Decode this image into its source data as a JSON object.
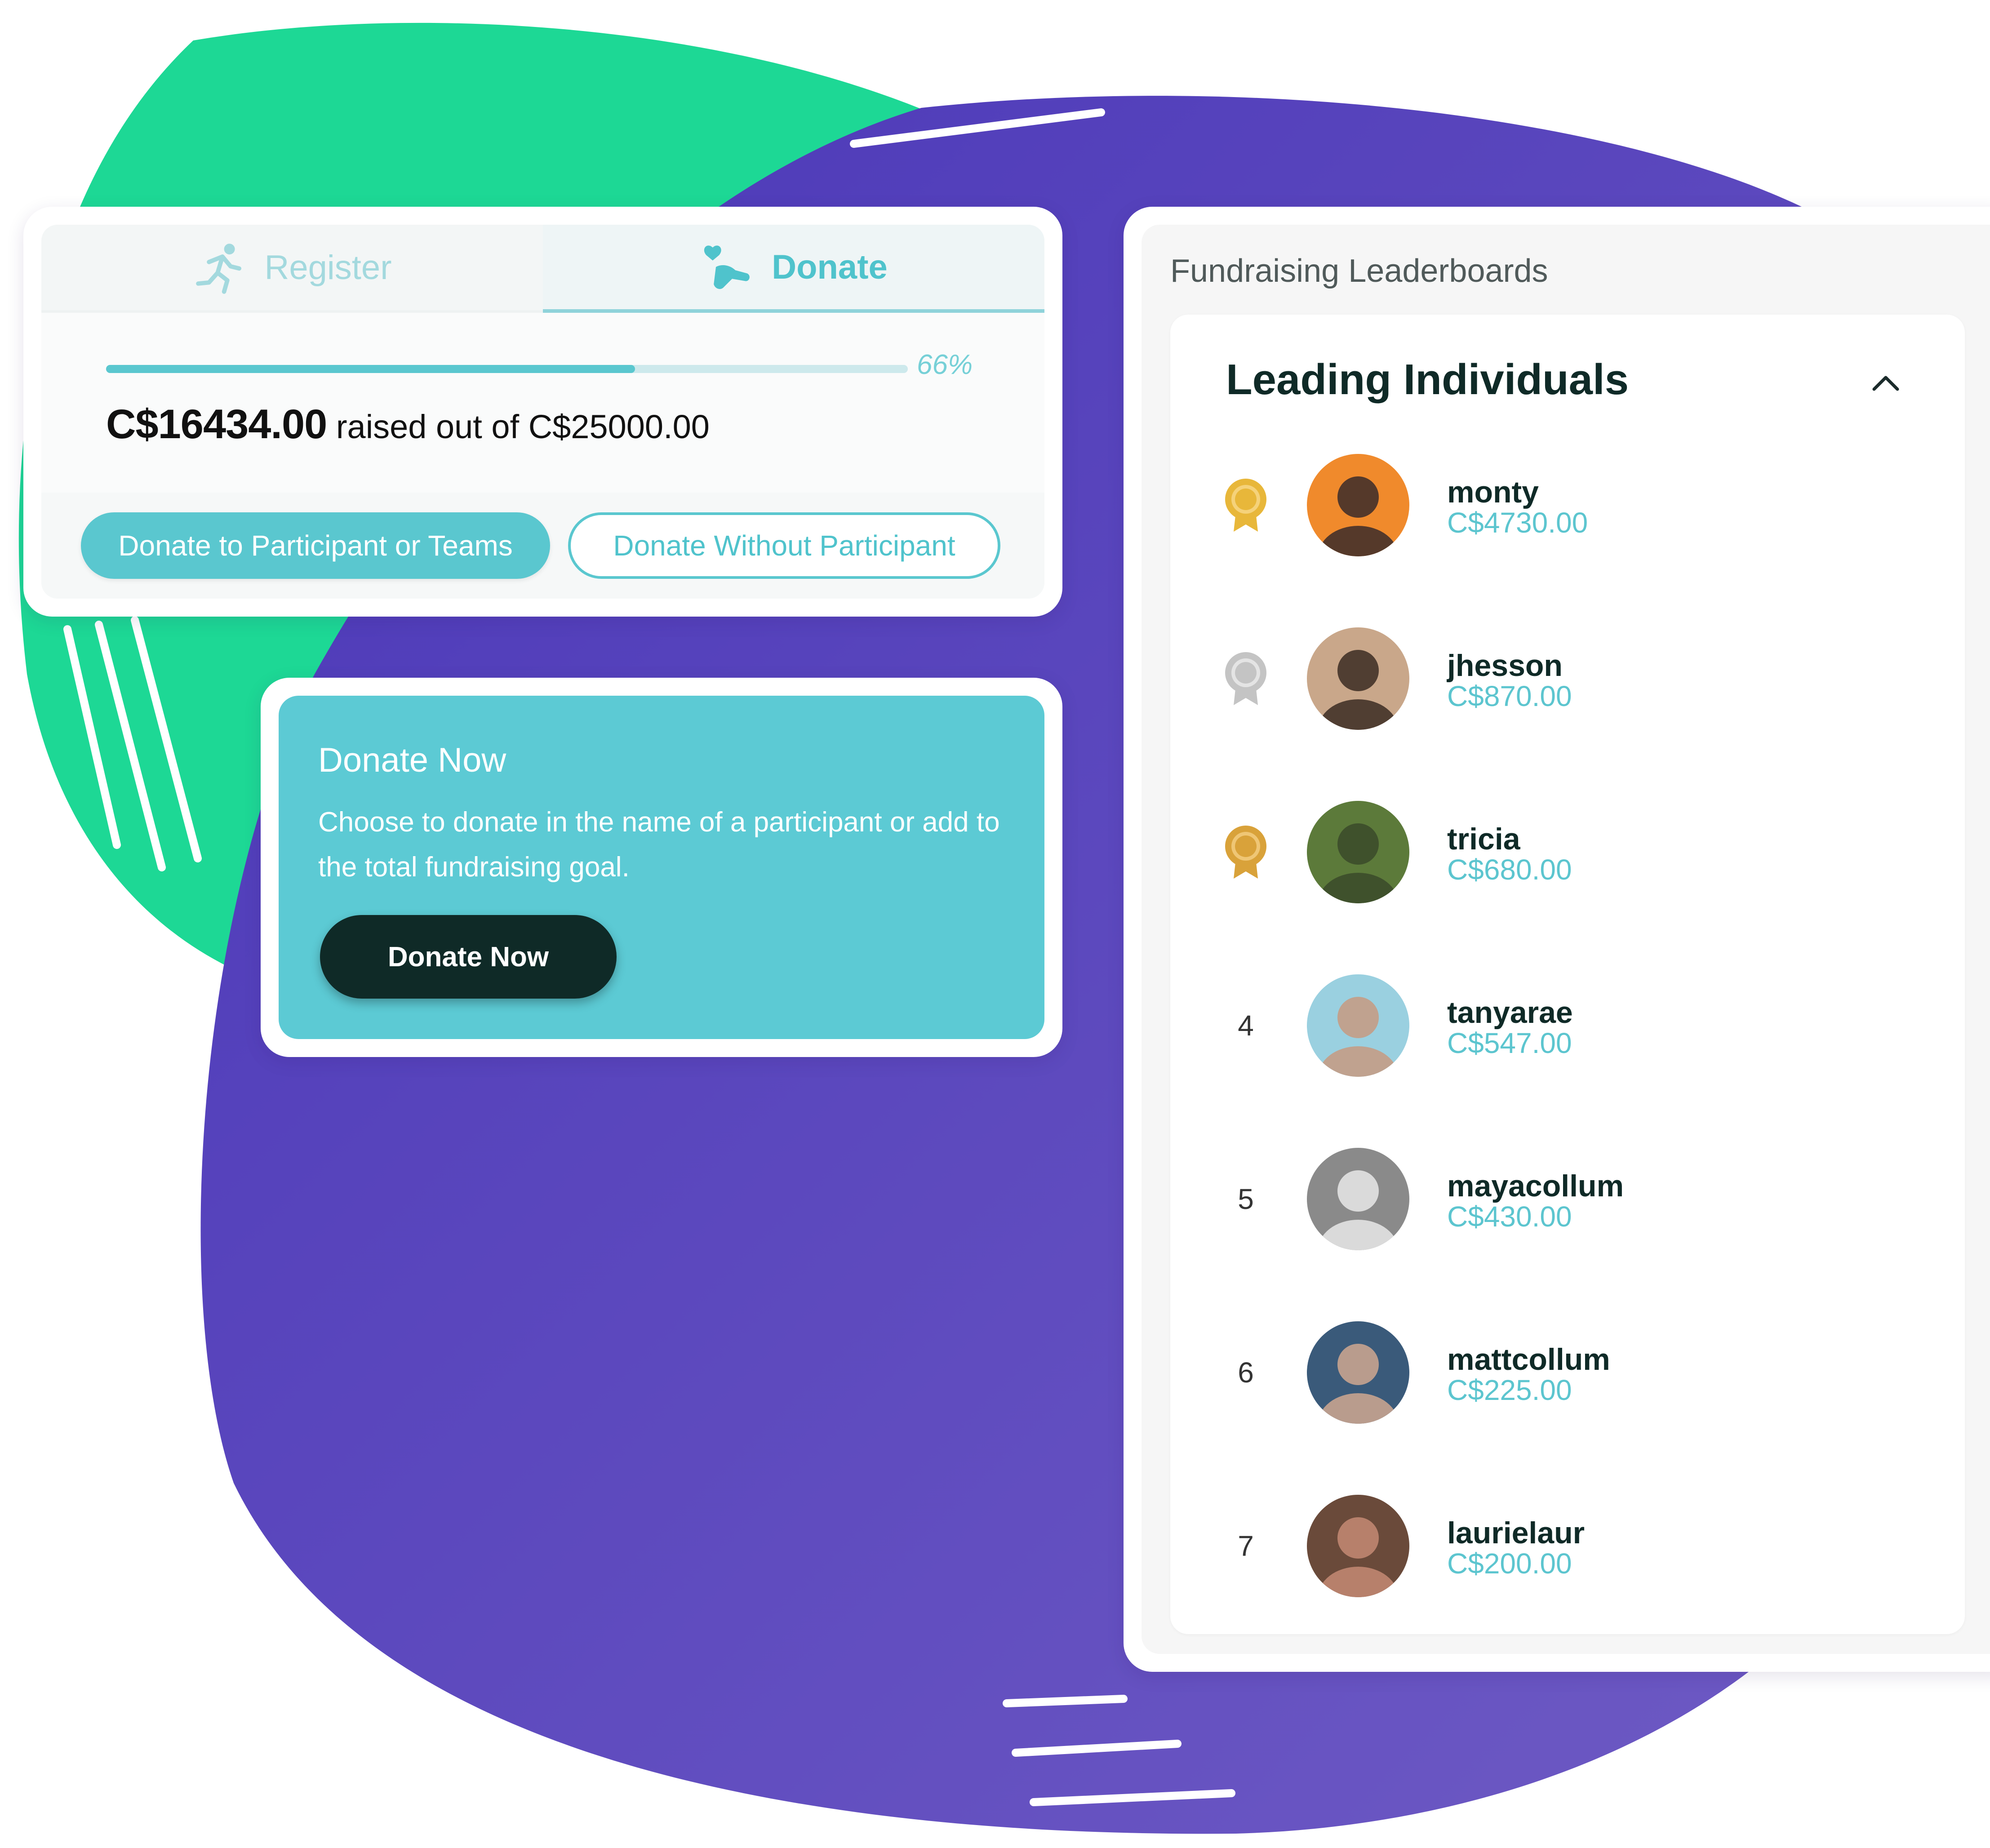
{
  "colors": {
    "teal_accent": "#5ac7cf",
    "donate_now_bg": "#5ccad4",
    "dark_button": "#0f2a27",
    "blob_green": "#1dd895",
    "blob_purple": "#5540bc",
    "gold_medal": "#e8b73a",
    "silver_medal": "#c9c9c9"
  },
  "tabs": {
    "register": {
      "label": "Register",
      "icon": "runner-icon"
    },
    "donate": {
      "label": "Donate",
      "icon": "hand-heart-icon",
      "active": true
    }
  },
  "progress": {
    "percent": 66,
    "percent_label": "66%",
    "raised": "C$16434.00",
    "raised_suffix": "raised out of C$25000.00"
  },
  "buttons": {
    "donate_participant": "Donate to Participant or Teams",
    "donate_without": "Donate Without Participant"
  },
  "donate_now": {
    "title": "Donate Now",
    "text": "Choose to donate in the name of a participant or add to the total fundraising goal.",
    "button": "Donate Now"
  },
  "leaderboard": {
    "heading": "Fundraising Leaderboards",
    "title": "Leading Individuals",
    "chevron": "chevron-up-icon",
    "rows": [
      {
        "rank": "1",
        "medal": "gold",
        "name": "monty",
        "amount": "C$4730.00"
      },
      {
        "rank": "2",
        "medal": "silver",
        "name": "jhesson",
        "amount": "C$870.00"
      },
      {
        "rank": "3",
        "medal": "bronze",
        "name": "tricia",
        "amount": "C$680.00"
      },
      {
        "rank": "4",
        "medal": "",
        "name": "tanyarae",
        "amount": "C$547.00"
      },
      {
        "rank": "5",
        "medal": "",
        "name": "mayacollum",
        "amount": "C$430.00"
      },
      {
        "rank": "6",
        "medal": "",
        "name": "mattcollum",
        "amount": "C$225.00"
      },
      {
        "rank": "7",
        "medal": "",
        "name": "laurielaur",
        "amount": "C$200.00"
      }
    ]
  }
}
